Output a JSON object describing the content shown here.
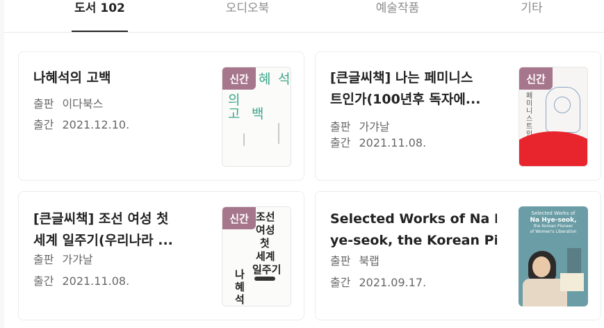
{
  "tabs": [
    {
      "label": "도서",
      "count": "102",
      "active": true
    },
    {
      "label": "오디오북"
    },
    {
      "label": "예술작품"
    },
    {
      "label": "기타"
    }
  ],
  "labels": {
    "publisher": "출판",
    "pubdate": "출간",
    "new_badge": "신간"
  },
  "books": [
    {
      "title": "나혜석의 고백",
      "publisher": "이다북스",
      "date": "2021.12.10.",
      "is_new": true,
      "cover_text": [
        "혜",
        "석",
        "의",
        "고",
        "백"
      ]
    },
    {
      "title_line1": "[큰글씨책] 나는 페미니스",
      "title_line2": "트인가(100년후 독자에...",
      "publisher": "가갸날",
      "date": "2021.11.08.",
      "is_new": true,
      "cover_text": "페미니스트인가"
    },
    {
      "title_line1": "[큰글씨책] 조선 여성 첫",
      "title_line2": "세계 일주기(우리나라 ...",
      "publisher": "가갸날",
      "date": "2021.11.08.",
      "is_new": true,
      "cover_text": [
        "조선",
        "여성",
        "첫",
        "세계",
        "일주기",
        "나",
        "혜",
        "석"
      ]
    },
    {
      "title_line1": "Selected Works of Na H",
      "title_line2": "ye-seok, the Korean Pi...",
      "publisher": "북랩",
      "date": "2021.09.17.",
      "is_new": false,
      "cover_text": [
        "Selected Works of",
        "Na Hye-seok,",
        "the Korean Pioneer",
        "of Women's Liberation"
      ]
    }
  ],
  "colors": {
    "badge": "#a6768d",
    "active_tab": "#222222",
    "inactive_tab": "#8b8b8b"
  }
}
